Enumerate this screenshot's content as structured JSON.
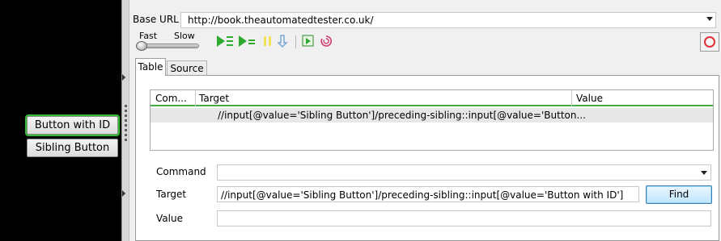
{
  "page": {
    "buttons": [
      "Button with ID",
      "Sibling Button"
    ]
  },
  "ide": {
    "base_url_label": "Base URL",
    "base_url_value": "http://book.theautomatedtester.co.uk/",
    "speed": {
      "fast_label": "Fast",
      "slow_label": "Slow"
    },
    "toolbar_icons": [
      "play-suite-icon",
      "play-test-icon",
      "pause-icon",
      "step-icon",
      "rollup-icon",
      "schedule-icon",
      "record-icon"
    ],
    "tabs": [
      "Table",
      "Source"
    ],
    "active_tab": "Table",
    "table": {
      "columns": [
        "Com...",
        "Target",
        "Value"
      ],
      "rows": [
        {
          "command": "",
          "target": "//input[@value='Sibling Button']/preceding-sibling::input[@value='Button...",
          "value": ""
        }
      ]
    },
    "form": {
      "command_label": "Command",
      "command_value": "",
      "target_label": "Target",
      "target_value": "//input[@value='Sibling Button']/preceding-sibling::input[@value='Button with ID']",
      "value_label": "Value",
      "value_value": "",
      "find_label": "Find"
    }
  },
  "colors": {
    "accent_green": "#33bb33",
    "record_red": "#e0313b",
    "play_green": "#2eaa2e"
  }
}
